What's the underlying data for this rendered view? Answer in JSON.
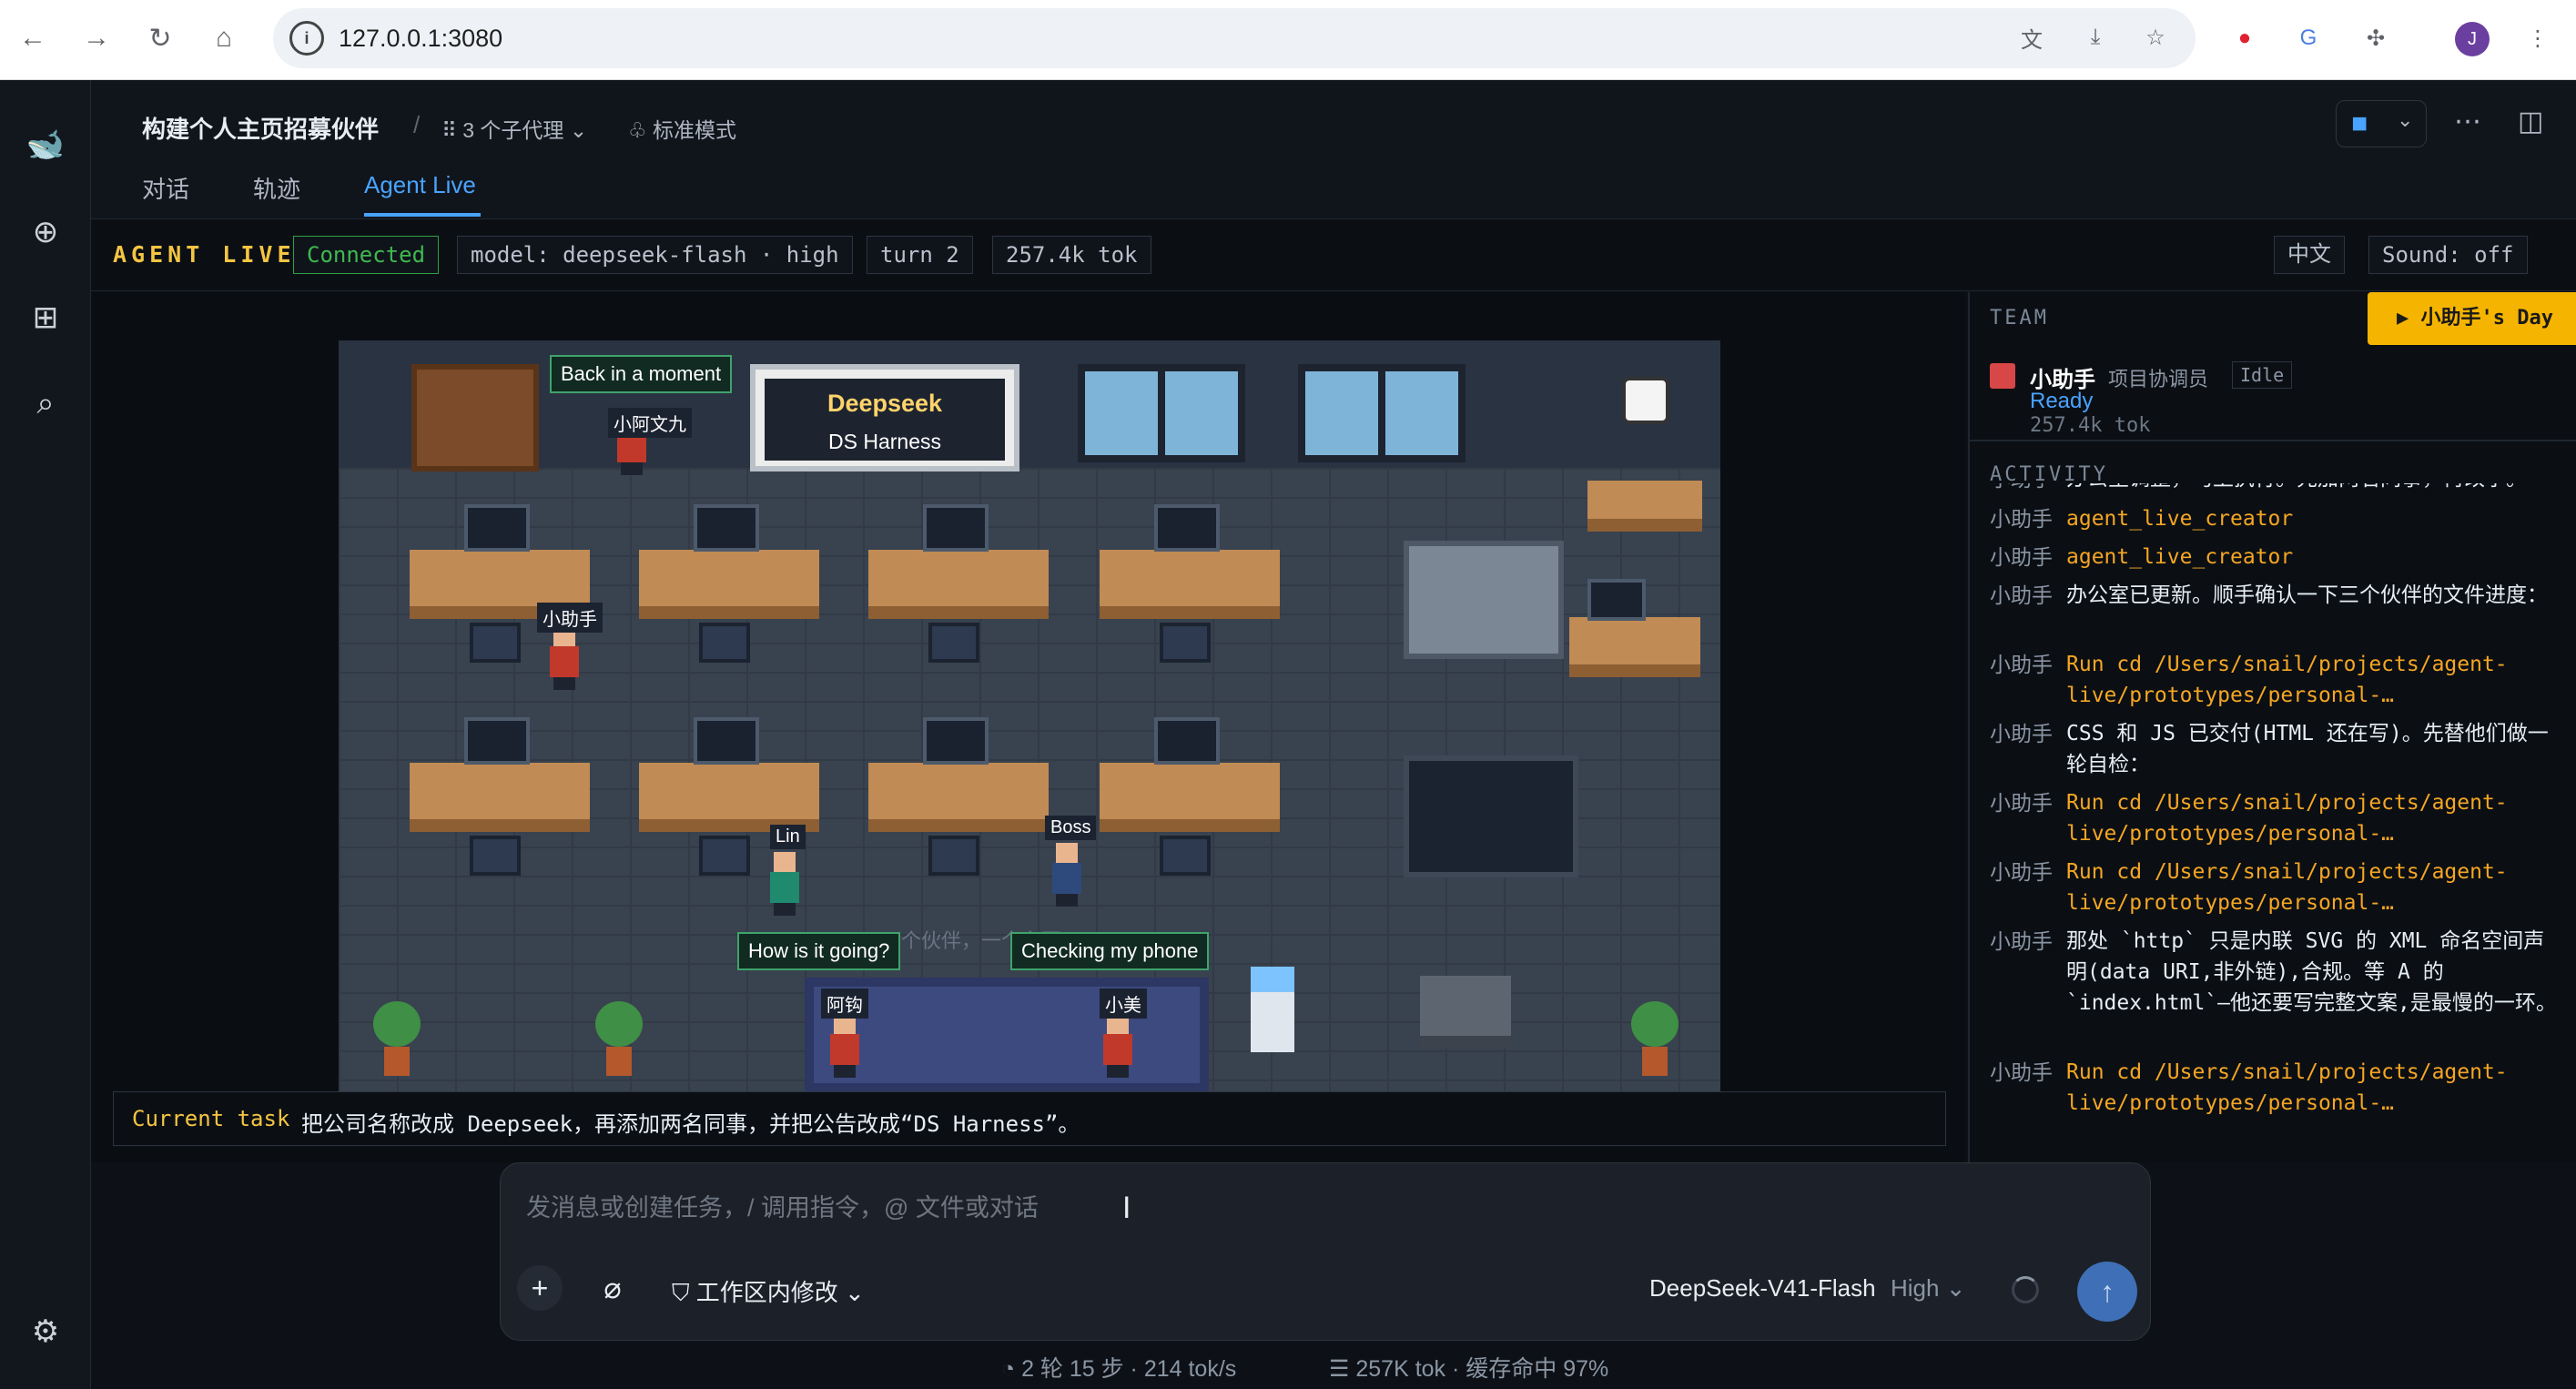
{
  "browser": {
    "url": "127.0.0.1:3080",
    "avatar_letter": "J"
  },
  "header": {
    "title": "构建个人主页招募伙伴",
    "separator": "/",
    "subagents": "3 个子代理",
    "mode": "标准模式",
    "tabs": [
      {
        "label": "对话"
      },
      {
        "label": "轨迹"
      },
      {
        "label": "Agent Live"
      }
    ]
  },
  "statusbar": {
    "title": "AGENT LIVE",
    "connection": "Connected",
    "model": "model: deepseek-flash · high",
    "turn": "turn 2",
    "tokens": "257.4k tok",
    "lang_button": "中文",
    "sound_button": "Sound: off"
  },
  "office": {
    "sign_line1": "Deepseek",
    "sign_line2": "DS Harness",
    "faded_text": "三个伙伴，一个主页",
    "bubbles": {
      "top": "Back in a moment",
      "left": "How is it going?",
      "right": "Checking my phone"
    },
    "people": {
      "p1": "小阿文九",
      "p2": "小助手",
      "p3": "Lin",
      "p4": "Boss",
      "p5": "阿钩",
      "p6": "小美"
    }
  },
  "task": {
    "label": "Current task",
    "text": "把公司名称改成 Deepseek，再添加两名同事，并把公告改成“DS Harness”。"
  },
  "panel": {
    "team_label": "TEAM",
    "day_button": "▶ 小助手's Day",
    "agent": {
      "name": "小助手",
      "role": "项目协调员",
      "state": "Idle",
      "status": "Ready",
      "tokens": "257.4k tok"
    },
    "activity_label": "ACTIVITY",
    "activity": [
      {
        "who": "小助手",
        "msg": "办公室调整，马上执行。先加两名同事，再改字。",
        "cmd": false
      },
      {
        "who": "小助手",
        "msg": "agent_live_creator",
        "cmd": true
      },
      {
        "who": "小助手",
        "msg": "agent_live_creator",
        "cmd": true
      },
      {
        "who": "小助手",
        "msg": "办公室已更新。顺手确认一下三个伙伴的文件进度：",
        "cmd": false
      },
      {
        "who": "小助手",
        "msg": "Run cd /Users/snail/projects/agent-live/prototypes/personal-…",
        "cmd": true
      },
      {
        "who": "小助手",
        "msg": "CSS 和 JS 已交付(HTML 还在写)。先替他们做一轮自检：",
        "cmd": false
      },
      {
        "who": "小助手",
        "msg": "Run cd /Users/snail/projects/agent-live/prototypes/personal-…",
        "cmd": true
      },
      {
        "who": "小助手",
        "msg": "Run cd /Users/snail/projects/agent-live/prototypes/personal-…",
        "cmd": true
      },
      {
        "who": "小助手",
        "msg": "那处 `http` 只是内联 SVG 的 XML 命名空间声明(data URI,非外链),合规。等 A 的 `index.html`—他还要写完整文案,是最慢的一环。",
        "cmd": false
      },
      {
        "who": "小助手",
        "msg": "Run cd /Users/snail/projects/agent-live/prototypes/personal-…",
        "cmd": true
      }
    ]
  },
  "composer": {
    "placeholder": "发消息或创建任务，/ 调用指令，@ 文件或对话",
    "mode": "工作区内修改",
    "model": "DeepSeek-V41-Flash",
    "level": "High"
  },
  "footer": {
    "steps": "2 轮 15 步 · 214 tok/s",
    "cache": "257K tok · 缓存命中 97%"
  },
  "colors": {
    "accent": "#4aa3ff",
    "warning": "#f5c542",
    "success": "#3fb950",
    "command": "#f5a623"
  }
}
